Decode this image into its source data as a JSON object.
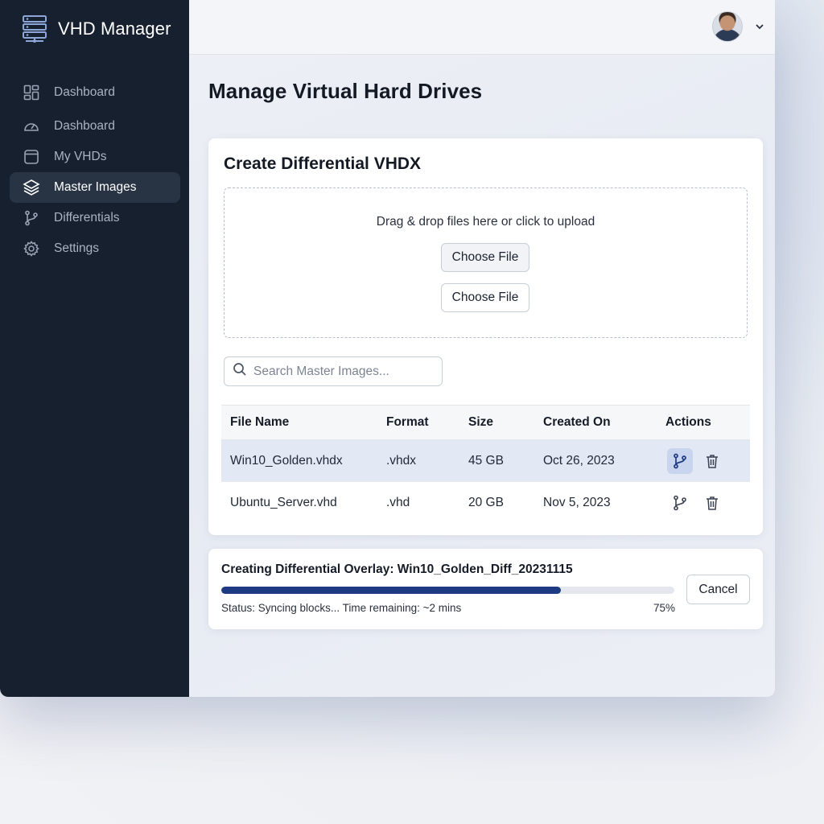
{
  "app": {
    "title": "VHD Manager"
  },
  "sidebar": {
    "items": [
      {
        "label": "Dashboard",
        "icon": "grid-icon",
        "active": false
      },
      {
        "label": "Dashboard",
        "icon": "gauge-icon",
        "active": false
      },
      {
        "label": "My VHDs",
        "icon": "drive-icon",
        "active": false
      },
      {
        "label": "Master Images",
        "icon": "layers-icon",
        "active": true
      },
      {
        "label": "Differentials",
        "icon": "branch-icon",
        "active": false
      },
      {
        "label": "Settings",
        "icon": "gear-icon",
        "active": false
      }
    ]
  },
  "header": {
    "avatar_icon": "user-avatar",
    "menu_icon": "chevron-down-icon"
  },
  "page": {
    "title": "Manage Virtual Hard Drives"
  },
  "create_card": {
    "title": "Create Differential VHDX",
    "dropzone_text": "Drag & drop files here or click to upload",
    "choose_file_1": "Choose File",
    "choose_file_2": "Choose File",
    "search_placeholder": "Search Master Images..."
  },
  "table": {
    "headers": [
      "File Name",
      "Format",
      "Size",
      "Created On",
      "Actions"
    ],
    "rows": [
      {
        "name": "Win10_Golden.vhdx",
        "format": ".vhdx",
        "size": "45 GB",
        "created": "Oct 26, 2023",
        "selected": true
      },
      {
        "name": "Ubuntu_Server.vhd",
        "format": ".vhd",
        "size": "20 GB",
        "created": "Nov 5, 2023",
        "selected": false
      }
    ]
  },
  "progress": {
    "title": "Creating Differential Overlay: Win10_Golden_Diff_20231115",
    "status": "Status: Syncing blocks...  Time remaining: ~2 mins",
    "percent_label": "75%",
    "percent_value": 0.75,
    "cancel_label": "Cancel"
  },
  "colors": {
    "sidebar_bg": "#17202f",
    "accent": "#1e3a82",
    "selected_row": "#e3e8f5"
  }
}
